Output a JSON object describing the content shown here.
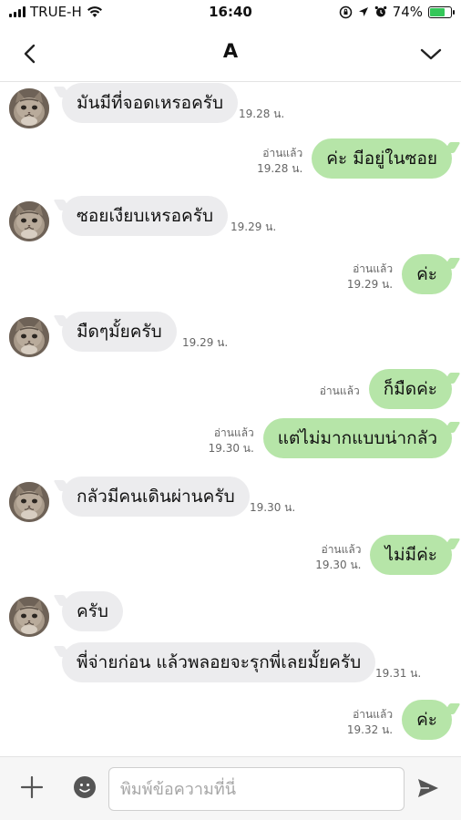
{
  "status_bar": {
    "carrier": "TRUE-H",
    "time": "16:40",
    "battery": "74%",
    "battery_level": 0.74
  },
  "header": {
    "title": "A",
    "back_icon": "chevron-left-icon",
    "menu_icon": "chevron-down-icon"
  },
  "messages": [
    {
      "side": "in",
      "text": "มันมีที่จอดเหรอครับ",
      "time": "19.28 น.",
      "avatar": true
    },
    {
      "side": "out",
      "text": "ค่ะ มีอยู่ในซอย",
      "read": "อ่านแล้ว",
      "time": "19.28 น."
    },
    {
      "side": "in",
      "text": "ซอยเงียบเหรอครับ",
      "time": "19.29 น.",
      "avatar": true
    },
    {
      "side": "out",
      "text": "ค่ะ",
      "read": "อ่านแล้ว",
      "time": "19.29 น."
    },
    {
      "side": "in",
      "text": "มืดๆมั้ยครับ",
      "time": "19.29 น.",
      "avatar": true
    },
    {
      "side": "out",
      "text": "ก็มืดค่ะ",
      "read": "อ่านแล้ว",
      "time": ""
    },
    {
      "side": "out",
      "text": "แต่ไม่มากแบบน่ากลัว",
      "read": "อ่านแล้ว",
      "time": "19.30 น."
    },
    {
      "side": "in",
      "text": "กลัวมีคนเดินผ่านครับ",
      "time": "19.30 น.",
      "avatar": true
    },
    {
      "side": "out",
      "text": "ไม่มีค่ะ",
      "read": "อ่านแล้ว",
      "time": "19.30 น."
    },
    {
      "side": "in",
      "text": "ครับ",
      "time": "",
      "avatar": true
    },
    {
      "side": "in",
      "text": "พี่จ่ายก่อน แล้วพลอยจะรุกพี่เลยมั้ยครับ",
      "time": "19.31 น.",
      "avatar": false
    },
    {
      "side": "out",
      "text": "ค่ะ",
      "read": "อ่านแล้ว",
      "time": "19.32 น."
    }
  ],
  "input_bar": {
    "placeholder": "พิมพ์ข้อความที่นี่",
    "plus_icon": "plus-icon",
    "emoji_icon": "emoji-icon",
    "send_icon": "send-icon"
  }
}
